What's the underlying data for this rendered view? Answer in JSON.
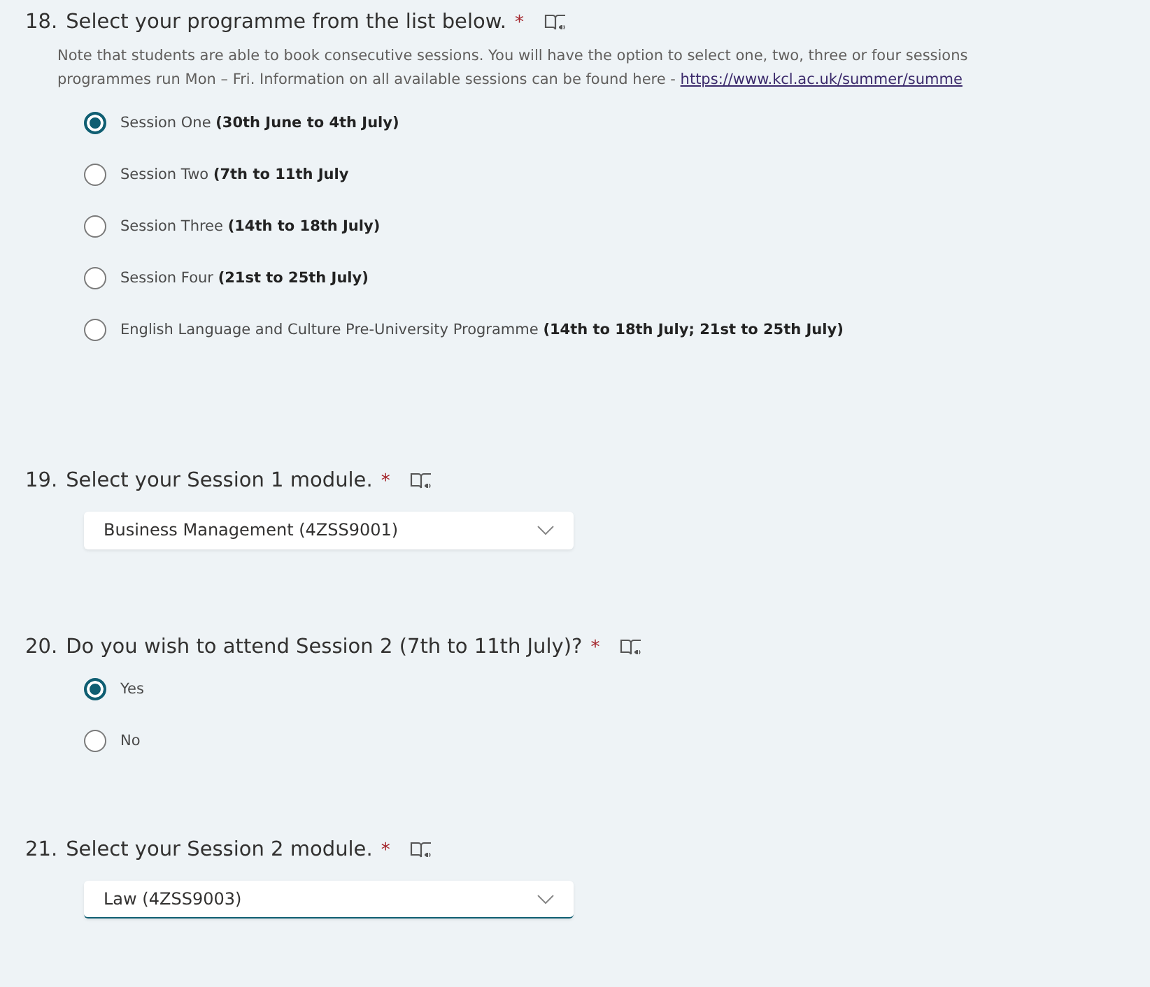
{
  "questions": [
    {
      "kind": "choice",
      "number": "18.",
      "title": "Select your programme from the list below.",
      "required": "*",
      "note_lines": [
        "Note that students are able to book consecutive sessions. You will have the option to select one, two, three or four sessions",
        "programmes run Mon – Fri. Information on all available sessions can be found here - "
      ],
      "note_link": "https://www.kcl.ac.uk/summer/summe",
      "options": [
        {
          "label": "Session One **(30th June to 4th July)**",
          "selected": true
        },
        {
          "label": "Session Two **(7th to 11th July**",
          "selected": false
        },
        {
          "label": "Session Three **(14th to 18th July)**",
          "selected": false
        },
        {
          "label": "Session Four **(21st to 25th July)**",
          "selected": false
        },
        {
          "label": "English Language and Culture Pre-University Programme **(14th to 18th July; 21st to 25th July)**",
          "selected": false
        }
      ]
    },
    {
      "kind": "dropdown",
      "number": "19.",
      "title": "Select your Session 1 module.",
      "required": "*",
      "value": "Business Management (4ZSS9001)",
      "focused": false
    },
    {
      "kind": "choice",
      "number": "20.",
      "title": "Do you wish to attend Session 2 (7th to 11th July)?",
      "required": "*",
      "options": [
        {
          "label": "Yes",
          "selected": true
        },
        {
          "label": "No",
          "selected": false
        }
      ]
    },
    {
      "kind": "dropdown",
      "number": "21.",
      "title": "Select your Session 2 module.",
      "required": "*",
      "value": "Law (4ZSS9003)",
      "focused": true
    }
  ]
}
